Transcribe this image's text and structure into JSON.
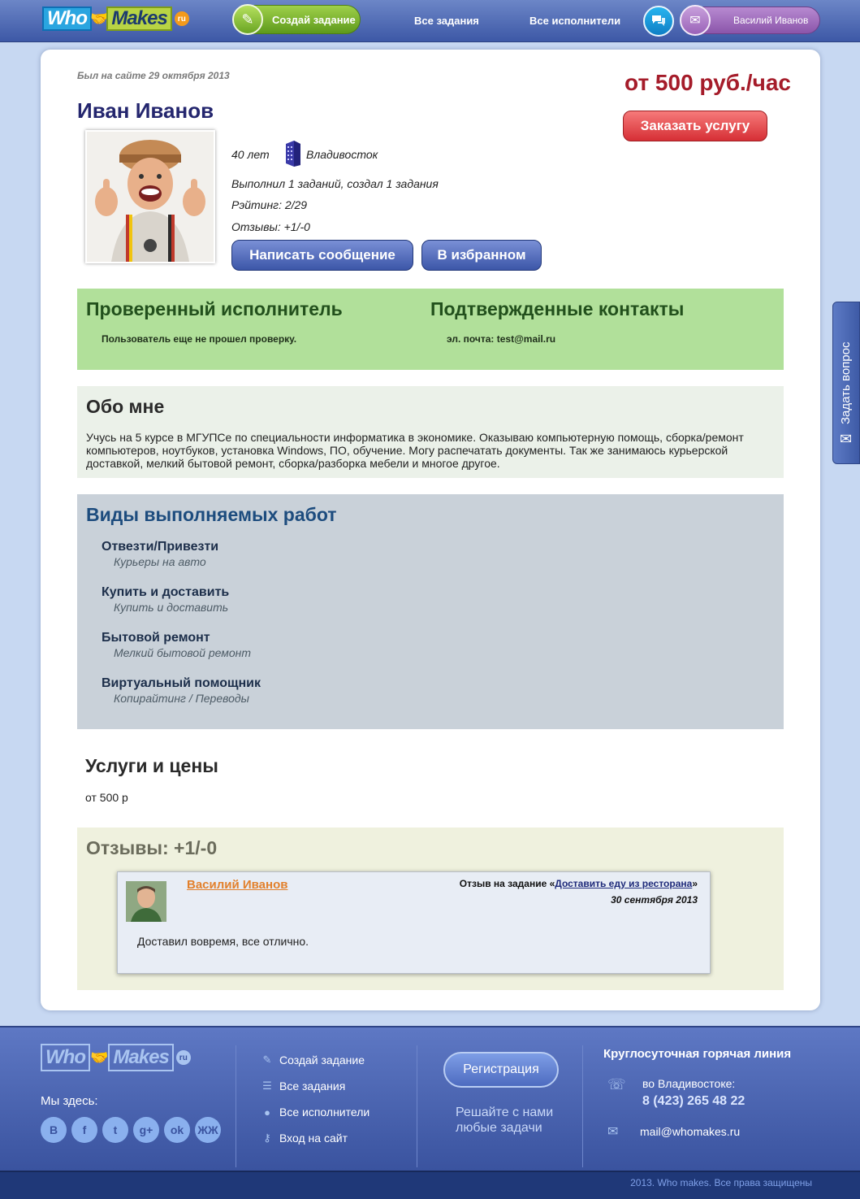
{
  "header": {
    "logo_left": "Who",
    "logo_right": "Makes",
    "logo_tld": "ru",
    "create_task": "Создай задание",
    "nav_all_tasks": "Все задания",
    "nav_all_performers": "Все исполнители",
    "user_name": "Василий Иванов",
    "icons": {
      "create": "pencil-icon",
      "chat": "chat-bubbles-icon",
      "mail": "envelope-icon"
    },
    "accent_green": "#6aa523",
    "accent_purple": "#9a62b8"
  },
  "side_tab": {
    "label": "Задать вопрос",
    "icon": "envelope-icon"
  },
  "profile": {
    "last_seen": "Был на сайте 29 октября 2013",
    "name": "Иван Иванов",
    "price": "от 500 руб./час",
    "order_button": "Заказать услугу",
    "age": "40 лет",
    "city": "Владивосток",
    "city_icon": "building-icon",
    "stats": "Выполнил 1 заданий, создал 1 задания",
    "rating": "Рэйтинг: 2/29",
    "reviews": "Отзывы: +1/-0",
    "message_button": "Написать сообщение",
    "favorite_button": "В избранном",
    "price_color": "#a51c2a"
  },
  "verified": {
    "title": "Проверенный исполнитель",
    "text": "Пользователь еще не прошел проверку.",
    "contacts_title": "Подтвержденные контакты",
    "contacts_text": "эл. почта: test@mail.ru"
  },
  "about": {
    "title": "Обо мне",
    "text": "Учусь на 5 курсе в МГУПСе по специальности информатика в экономике. Оказываю компьютерную помощь, сборка/ремонт компьютеров, ноутбуков, установка Windows, ПО, обучение. Могу распечатать документы. Так же занимаюсь курьерской доставкой, мелкий бытовой ремонт, сборка/разборка мебели и многое другое."
  },
  "works": {
    "title": "Виды выполняемых работ",
    "items": [
      {
        "title": "Отвезти/Привезти",
        "sub": "Курьеры на авто"
      },
      {
        "title": "Купить и доставить",
        "sub": "Купить и доставить"
      },
      {
        "title": "Бытовой ремонт",
        "sub": "Мелкий бытовой ремонт"
      },
      {
        "title": "Виртуальный помощник",
        "sub": "Копирайтинг / Переводы"
      }
    ]
  },
  "services": {
    "title": "Услуги и цены",
    "price": "от 500 р"
  },
  "reviews": {
    "title": "Отзывы: +1/-0",
    "items": [
      {
        "author": "Василий Иванов",
        "task_prefix": "Отзыв на задание «",
        "task_link": "Доставить еду из ресторана",
        "task_suffix": "»",
        "date": "30 сентября 2013",
        "text": "Доставил вовремя, все отлично."
      }
    ]
  },
  "footer": {
    "logo_left": "Who",
    "logo_right": "Makes",
    "logo_tld": "ru",
    "we_here": "Мы здесь:",
    "socials": [
      "В",
      "f",
      "t",
      "g+",
      "ok",
      "ЖЖ"
    ],
    "social_icons": [
      "vk-icon",
      "facebook-icon",
      "twitter-icon",
      "google-plus-icon",
      "odnoklassniki-icon",
      "livejournal-icon"
    ],
    "links": [
      {
        "label": "Создай задание",
        "icon": "pencil-icon"
      },
      {
        "label": "Все задания",
        "icon": "list-icon"
      },
      {
        "label": "Все исполнители",
        "icon": "person-icon"
      },
      {
        "label": "Вход на сайт",
        "icon": "key-icon"
      }
    ],
    "register_button": "Регистрация",
    "slogan": "Решайте с нами любые задачи",
    "hotline_title": "Круглосуточная горячая линия",
    "hotline_city": "во Владивостоке:",
    "hotline_phone": "8 (423) 265 48 22",
    "email": "mail@whomakes.ru",
    "copyright": "2013. Who makes. Все права защищены"
  }
}
